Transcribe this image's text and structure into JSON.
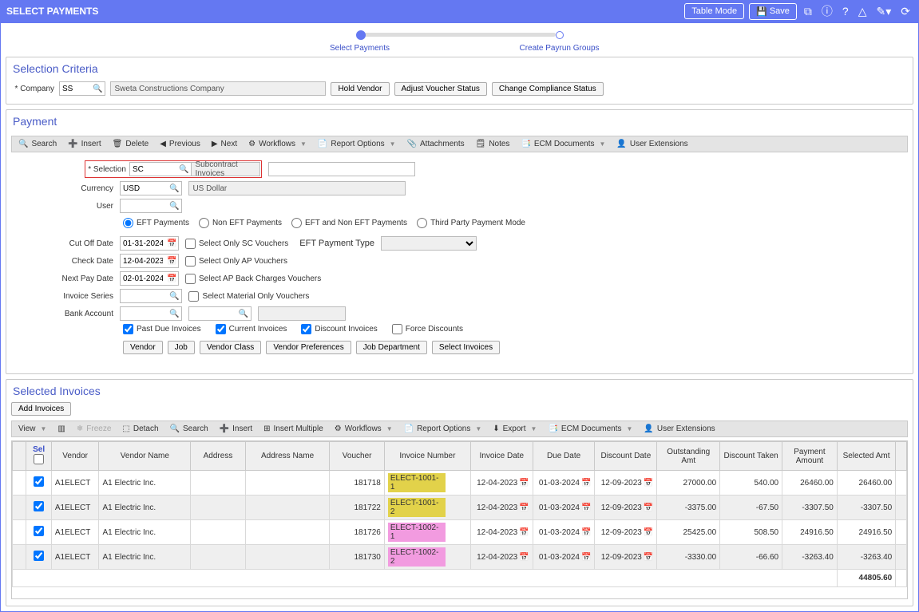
{
  "header": {
    "title": "SELECT PAYMENTS",
    "table_mode": "Table Mode",
    "save": "Save"
  },
  "stepper": {
    "step1": "Select Payments",
    "step2": "Create Payrun Groups"
  },
  "criteria": {
    "title": "Selection Criteria",
    "company_label": "* Company",
    "company_code": "SS",
    "company_name": "Sweta Constructions Company",
    "hold_vendor": "Hold Vendor",
    "adjust_voucher": "Adjust Voucher Status",
    "change_compliance": "Change Compliance Status"
  },
  "payment": {
    "title": "Payment",
    "toolbar": {
      "search": "Search",
      "insert": "Insert",
      "delete": "Delete",
      "previous": "Previous",
      "next": "Next",
      "workflows": "Workflows",
      "report_options": "Report Options",
      "attachments": "Attachments",
      "notes": "Notes",
      "ecm": "ECM Documents",
      "user_ext": "User Extensions"
    },
    "selection_label": "* Selection",
    "selection_code": "SC",
    "selection_name": "Subcontract Invoices",
    "currency_label": "Currency",
    "currency_code": "USD",
    "currency_name": "US Dollar",
    "user_label": "User",
    "radios": {
      "eft": "EFT Payments",
      "noneft": "Non EFT Payments",
      "both": "EFT and Non EFT Payments",
      "third": "Third Party Payment Mode"
    },
    "cutoff_label": "Cut Off Date",
    "cutoff": "01-31-2024",
    "check_label": "Check Date",
    "check": "12-04-2023",
    "nextpay_label": "Next Pay Date",
    "nextpay": "02-01-2024",
    "invoice_series_label": "Invoice Series",
    "bank_label": "Bank Account",
    "opts": {
      "sc_only": "Select Only SC Vouchers",
      "ap_only": "Select Only AP Vouchers",
      "ap_back": "Select AP Back Charges Vouchers",
      "material": "Select Material Only Vouchers",
      "eft_type": "EFT Payment Type"
    },
    "checks": {
      "past_due": "Past Due Invoices",
      "current": "Current Invoices",
      "discount": "Discount Invoices",
      "force": "Force Discounts"
    },
    "filters": {
      "vendor": "Vendor",
      "job": "Job",
      "vclass": "Vendor Class",
      "vpref": "Vendor Preferences",
      "jobdept": "Job Department",
      "select_inv": "Select Invoices"
    }
  },
  "selected": {
    "title": "Selected Invoices",
    "add": "Add Invoices",
    "toolbar": {
      "view": "View",
      "freeze": "Freeze",
      "detach": "Detach",
      "search": "Search",
      "insert": "Insert",
      "insert_multi": "Insert Multiple",
      "workflows": "Workflows",
      "report_options": "Report Options",
      "export": "Export",
      "ecm": "ECM Documents",
      "user_ext": "User Extensions"
    },
    "cols": {
      "sel": "Sel",
      "vendor": "Vendor",
      "vname": "Vendor Name",
      "address": "Address",
      "aname": "Address Name",
      "voucher": "Voucher",
      "invno": "Invoice Number",
      "invdate": "Invoice Date",
      "duedate": "Due Date",
      "discdate": "Discount Date",
      "outstanding": "Outstanding Amt",
      "disctaken": "Discount Taken",
      "payamt": "Payment Amount",
      "selamt": "Selected Amt"
    },
    "rows": [
      {
        "vendor": "A1ELECT",
        "vname": "A1 Electric Inc.",
        "voucher": "181718",
        "invno": "ELECT-1001-1",
        "hl": "yellow",
        "invdate": "12-04-2023",
        "duedate": "01-03-2024",
        "discdate": "12-09-2023",
        "out": "27000.00",
        "disc": "540.00",
        "pay": "26460.00",
        "sel": "26460.00"
      },
      {
        "vendor": "A1ELECT",
        "vname": "A1 Electric Inc.",
        "voucher": "181722",
        "invno": "ELECT-1001-2",
        "hl": "yellow",
        "invdate": "12-04-2023",
        "duedate": "01-03-2024",
        "discdate": "12-09-2023",
        "out": "-3375.00",
        "disc": "-67.50",
        "pay": "-3307.50",
        "sel": "-3307.50"
      },
      {
        "vendor": "A1ELECT",
        "vname": "A1 Electric Inc.",
        "voucher": "181726",
        "invno": "ELECT-1002-1",
        "hl": "pink",
        "invdate": "12-04-2023",
        "duedate": "01-03-2024",
        "discdate": "12-09-2023",
        "out": "25425.00",
        "disc": "508.50",
        "pay": "24916.50",
        "sel": "24916.50"
      },
      {
        "vendor": "A1ELECT",
        "vname": "A1 Electric Inc.",
        "voucher": "181730",
        "invno": "ELECT-1002-2",
        "hl": "pink",
        "invdate": "12-04-2023",
        "duedate": "01-03-2024",
        "discdate": "12-09-2023",
        "out": "-3330.00",
        "disc": "-66.60",
        "pay": "-3263.40",
        "sel": "-3263.40"
      }
    ],
    "total": "44805.60"
  }
}
